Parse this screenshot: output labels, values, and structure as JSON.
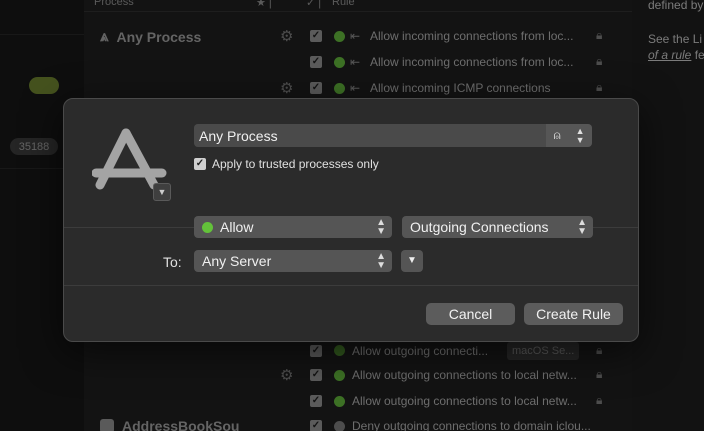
{
  "background": {
    "header": {
      "process": "Process",
      "rule": "Rule"
    },
    "left_badges": [
      "35188"
    ],
    "right_notes": {
      "line1": "defined by",
      "line2": "See the Li",
      "line3_link": "of a rule",
      "line3_rest": " fe"
    },
    "groups": [
      {
        "process": "Any Process",
        "rules": [
          {
            "text": "Allow incoming connections from loc..."
          },
          {
            "text": "Allow incoming connections from loc..."
          },
          {
            "text": "Allow incoming ICMP connections"
          }
        ]
      },
      {
        "rules": [
          {
            "text": "Allow outgoing connecti...",
            "tag": "macOS Se..."
          },
          {
            "text": "Allow outgoing connections to local netw..."
          },
          {
            "text": "Allow outgoing connections to local netw..."
          }
        ]
      },
      {
        "process": "AddressBookSou",
        "rules": [
          {
            "text": "Deny outgoing connections to domain iclou..."
          }
        ]
      }
    ]
  },
  "dialog": {
    "process_value": "Any Process",
    "trusted_label": "Apply to trusted processes only",
    "action": {
      "label": "Allow",
      "color": "#63c23a"
    },
    "direction": "Outgoing Connections",
    "to_label": "To:",
    "to_value": "Any Server",
    "cancel_label": "Cancel",
    "create_label": "Create Rule"
  }
}
